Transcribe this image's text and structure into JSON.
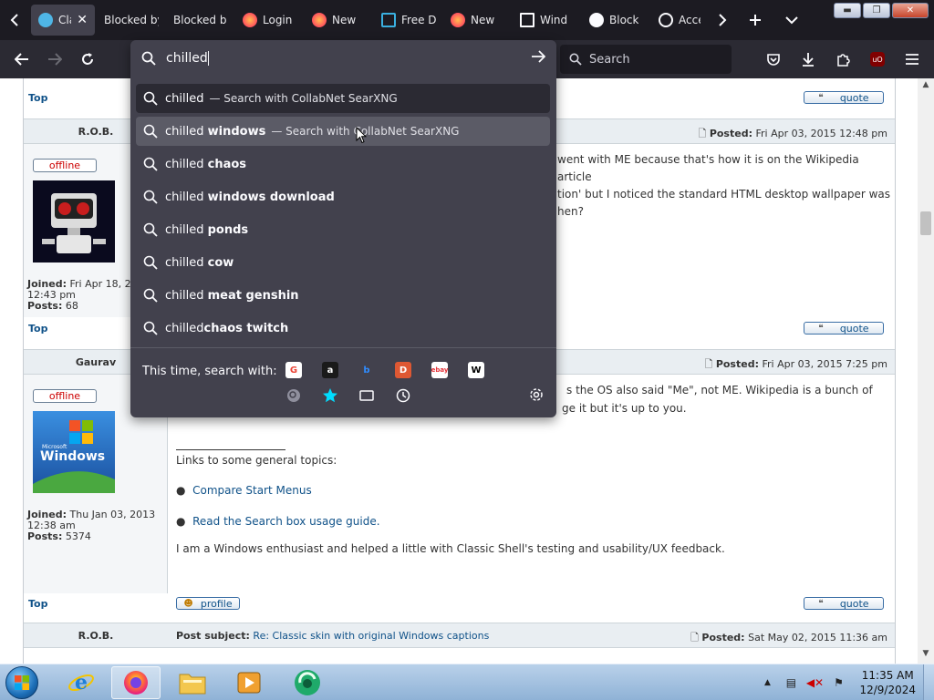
{
  "tabs": [
    {
      "label": "Cla",
      "active": true,
      "icon": "globe-icon"
    },
    {
      "label": "Blocked by",
      "icon": ""
    },
    {
      "label": "Blocked b",
      "icon": ""
    },
    {
      "label": "Login",
      "icon": "firefox-icon"
    },
    {
      "label": "New",
      "icon": "firefox-icon"
    },
    {
      "label": "Free D",
      "icon": "page-icon"
    },
    {
      "label": "New",
      "icon": "firefox-icon"
    },
    {
      "label": "Wind",
      "icon": "windows-icon"
    },
    {
      "label": "Block",
      "icon": "github-icon"
    },
    {
      "label": "Acce",
      "icon": "settings-icon"
    }
  ],
  "toolbar": {
    "search_placeholder": "Search"
  },
  "urlbar": {
    "value": "chilled",
    "suggestions": [
      {
        "prefix": "chilled",
        "suffix": "",
        "engine": "— Search with CollabNet SearXNG",
        "state": "selected"
      },
      {
        "prefix": "chilled ",
        "suffix": "windows",
        "engine": "— Search with CollabNet SearXNG",
        "state": "hover"
      },
      {
        "prefix": "chilled ",
        "suffix": "chaos",
        "engine": "",
        "state": ""
      },
      {
        "prefix": "chilled ",
        "suffix": "windows download",
        "engine": "",
        "state": ""
      },
      {
        "prefix": "chilled ",
        "suffix": "ponds",
        "engine": "",
        "state": ""
      },
      {
        "prefix": "chilled ",
        "suffix": "cow",
        "engine": "",
        "state": ""
      },
      {
        "prefix": "chilled ",
        "suffix": "meat genshin",
        "engine": "",
        "state": ""
      },
      {
        "prefix": "chilled",
        "suffix": "chaos twitch",
        "engine": "",
        "state": ""
      }
    ],
    "this_time_label": "This time, search with:",
    "engines": [
      {
        "name": "google-icon",
        "glyph": "G",
        "color": "#ea4335",
        "bg": "#ffffff"
      },
      {
        "name": "amazon-icon",
        "glyph": "a",
        "color": "#ffffff",
        "bg": "#1a1a1a"
      },
      {
        "name": "bing-icon",
        "glyph": "b",
        "color": "#2f8cff",
        "bg": "transparent"
      },
      {
        "name": "duckduckgo-icon",
        "glyph": "D",
        "color": "#ffffff",
        "bg": "#de5833"
      },
      {
        "name": "ebay-icon",
        "glyph": "ebay",
        "color": "#e53238",
        "bg": "#ffffff"
      },
      {
        "name": "wikipedia-icon",
        "glyph": "W",
        "color": "#000000",
        "bg": "#ffffff"
      }
    ]
  },
  "forum": {
    "top_label": "Top",
    "quote_label": "quote",
    "profile_label": "profile",
    "post1": {
      "author": "R.O.B.",
      "posted_label": "Posted:",
      "posted": "Fri Apr 03, 2015 12:48 pm",
      "status": "offline",
      "text_line1": "went with ME because that's how it is on the Wikipedia article",
      "text_line2": "tion' but I noticed the standard HTML desktop wallpaper was",
      "text_line3": "hen?",
      "joined_label": "Joined:",
      "joined": "Fri Apr 18, 2",
      "joined_time": "12:43 pm",
      "posts_label": "Posts:",
      "posts": "68"
    },
    "post2": {
      "author": "Gaurav",
      "posted_label": "Posted:",
      "posted": "Fri Apr 03, 2015 7:25 pm",
      "status": "offline",
      "text_line1": "s the OS also said \"Me\", not ME. Wikipedia is a bunch of",
      "text_line2": "ge it but it's up to you.",
      "links_heading": "Links to some general topics:",
      "link1": "Compare Start Menus",
      "link2": "Read the Search box usage guide.",
      "about": "I am a Windows enthusiast and helped a little with Classic Shell's testing and usability/UX feedback.",
      "joined_label": "Joined:",
      "joined": "Thu Jan 03, 2013",
      "joined_time": "12:38 am",
      "posts_label": "Posts:",
      "posts": "5374",
      "avatar_text": "Windows",
      "avatar_small": "Microsoft"
    },
    "post3": {
      "author": "R.O.B.",
      "subject_label": "Post subject:",
      "subject": "Re: Classic skin with original Windows captions",
      "posted_label": "Posted:",
      "posted": "Sat May 02, 2015 11:36 am"
    }
  },
  "taskbar": {
    "time": "11:35 AM",
    "date": "12/9/2024"
  }
}
